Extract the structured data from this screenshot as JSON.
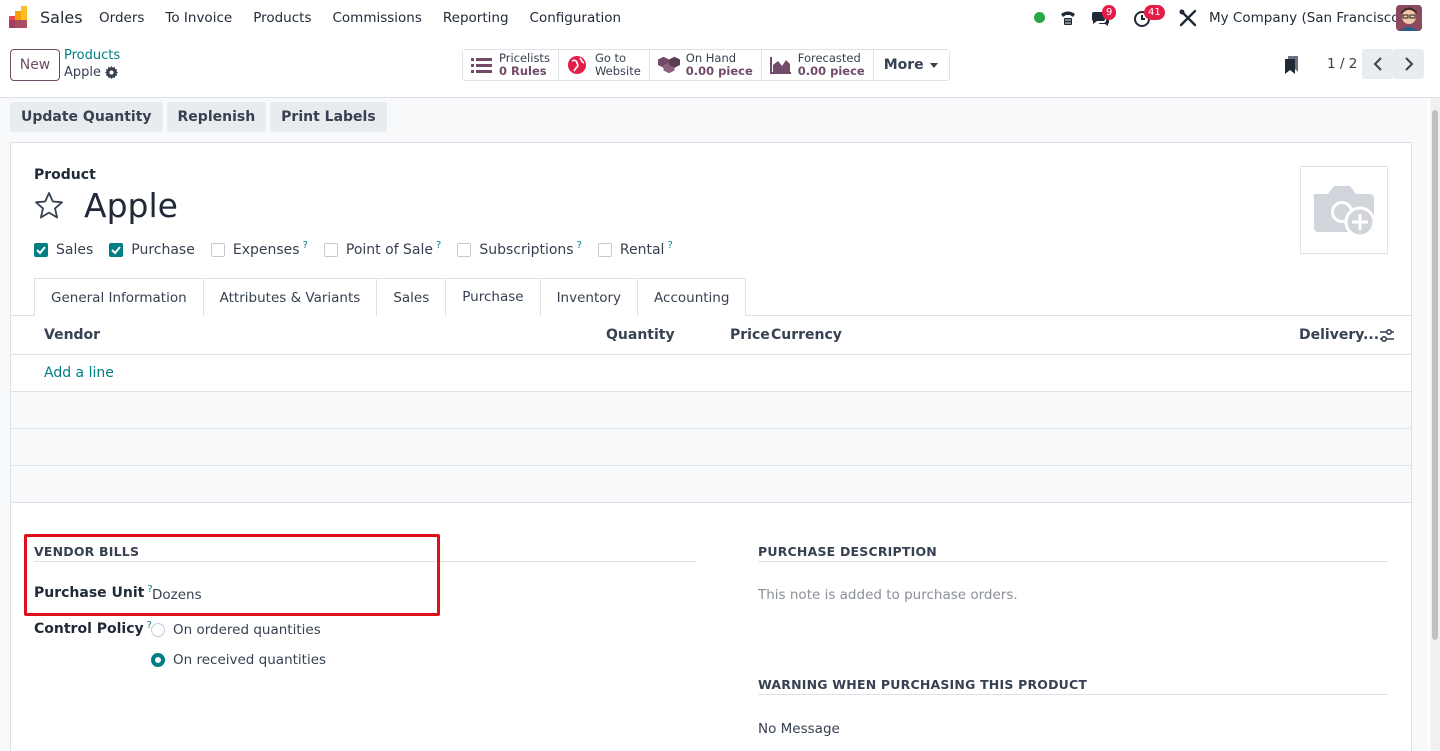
{
  "navbar": {
    "app_name": "Sales",
    "menu": [
      "Orders",
      "To Invoice",
      "Products",
      "Commissions",
      "Reporting",
      "Configuration"
    ],
    "messages_count": "9",
    "activities_count": "41",
    "company": "My Company (San Francisco)"
  },
  "control_panel": {
    "new_label": "New",
    "breadcrumb_parent": "Products",
    "breadcrumb_current": "Apple",
    "smart_buttons": {
      "pricelists_l1": "Pricelists",
      "pricelists_l2": "0 Rules",
      "website_l1": "Go to",
      "website_l2": "Website",
      "onhand_l1": "On Hand",
      "onhand_l2": "0.00 piece",
      "forecasted_l1": "Forecasted",
      "forecasted_l2": "0.00 piece",
      "more": "More"
    },
    "pager": "1 / 2"
  },
  "actions": [
    "Update Quantity",
    "Replenish",
    "Print Labels"
  ],
  "form": {
    "product_label": "Product",
    "product_name": "Apple",
    "checkboxes": [
      {
        "label": "Sales",
        "checked": true,
        "help": ""
      },
      {
        "label": "Purchase",
        "checked": true,
        "help": ""
      },
      {
        "label": "Expenses",
        "checked": false,
        "help": "?"
      },
      {
        "label": "Point of Sale",
        "checked": false,
        "help": "?"
      },
      {
        "label": "Subscriptions",
        "checked": false,
        "help": "?"
      },
      {
        "label": "Rental",
        "checked": false,
        "help": "?"
      }
    ],
    "tabs": [
      "General Information",
      "Attributes & Variants",
      "Sales",
      "Purchase",
      "Inventory",
      "Accounting"
    ],
    "active_tab": "Purchase",
    "vendor_table": {
      "headers": {
        "vendor": "Vendor",
        "quantity": "Quantity",
        "price": "Price",
        "currency": "Currency",
        "delivery": "Delivery..."
      },
      "add_line": "Add a line"
    },
    "vendor_bills": {
      "title": "VENDOR BILLS",
      "purchase_unit_label": "Purchase Unit",
      "purchase_unit_value": "Dozens",
      "control_policy_label": "Control Policy",
      "help": "?",
      "options": [
        {
          "label": "On ordered quantities",
          "selected": false
        },
        {
          "label": "On received quantities",
          "selected": true
        }
      ]
    },
    "purchase_description": {
      "title": "PURCHASE DESCRIPTION",
      "placeholder": "This note is added to purchase orders."
    },
    "warning": {
      "title": "WARNING WHEN PURCHASING THIS PRODUCT",
      "value": "No Message"
    }
  },
  "colors": {
    "brand": "#714b67",
    "accent": "#017e84",
    "highlight": "#e0101a"
  }
}
